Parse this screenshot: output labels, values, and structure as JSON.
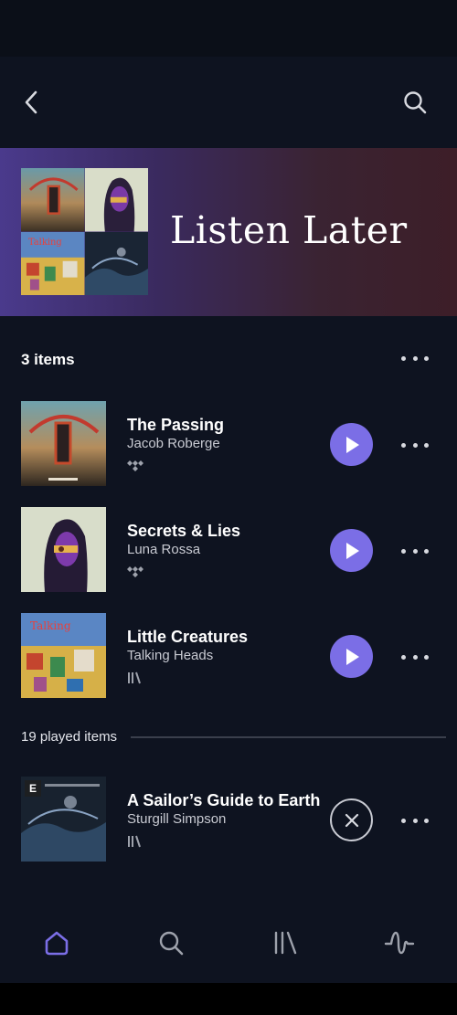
{
  "header": {
    "back_icon": "chevron-left-icon",
    "search_icon": "search-icon"
  },
  "hero": {
    "title": "Listen Later"
  },
  "list": {
    "count_label": "3 items"
  },
  "tracks": [
    {
      "title": "The Passing",
      "artist": "Jacob Roberge",
      "source_icon": "tidal-icon",
      "action": "play"
    },
    {
      "title": "Secrets & Lies",
      "artist": "Luna Rossa",
      "source_icon": "tidal-icon",
      "action": "play"
    },
    {
      "title": "Little Creatures",
      "artist": "Talking Heads",
      "source_icon": "library-icon",
      "action": "play"
    }
  ],
  "played": {
    "label": "19 played items",
    "items": [
      {
        "title": "A Sailor’s Guide to Earth",
        "artist": "Sturgill Simpson",
        "source_icon": "library-icon",
        "badge": "E",
        "action": "remove"
      }
    ]
  },
  "bottom_nav": [
    {
      "icon": "home-icon",
      "active": true
    },
    {
      "icon": "search-icon",
      "active": false
    },
    {
      "icon": "library-icon",
      "active": false
    },
    {
      "icon": "audio-wave-icon",
      "active": false
    }
  ],
  "colors": {
    "accent": "#7b6ee6",
    "background": "#0e1320"
  }
}
